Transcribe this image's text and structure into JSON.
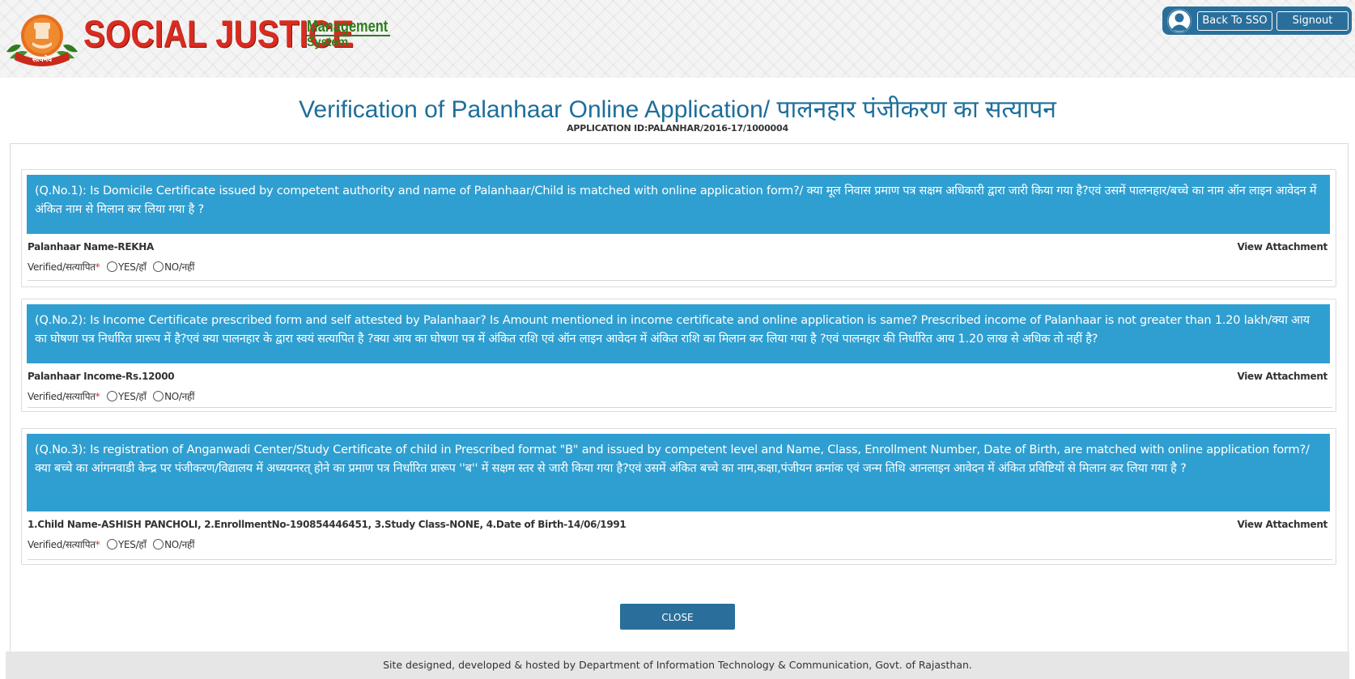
{
  "header": {
    "brand_main": "SOCIAL JUSTICE",
    "brand_sub1": "Management",
    "brand_sub2": "System",
    "back_to_sso": "Back To SSO",
    "signout": "Signout",
    "emblem_text": "सत्यमेव जयते"
  },
  "page": {
    "title": "Verification of Palanhaar Online Application/ पालनहार पंजीकरण का सत्यापन",
    "application_id": "APPLICATION ID:PALANHAR/2016-17/1000004"
  },
  "questions": [
    {
      "question_text": "(Q.No.1): Is Domicile Certificate issued by competent authority and name of Palanhaar/Child is matched with online application form?/ क्या मूल निवास प्रमाण पत्र सक्षम अधिकारी द्वारा जारी किया गया है?एवं उसमें पालनहार/बच्चे का नाम ऑन लाइन आवेदन में अंकित नाम से मिलान कर लिया गया है ?",
      "info": "Palanhaar Name-REKHA",
      "attachment_label": "View Attachment",
      "verified_label": "Verified/सत्यापित",
      "required_mark": "*",
      "yes_label": "YES/हाँ",
      "no_label": "NO/नहीं"
    },
    {
      "question_text": "(Q.No.2): Is Income Certificate prescribed form and self attested by Palanhaar? Is Amount mentioned in income certificate and online application is same? Prescribed income of Palanhaar is not greater than 1.20 lakh/क्या आय का घोषणा पत्र निर्धारित प्रारूप में है?एवं क्या पालनहार के द्वारा स्वयं सत्यापित है ?क्या आय का घोषणा पत्र में अंकित राशि एवं ऑन लाइन आवेदन में अंकित राशि का मिलान कर लिया गया है ?एवं पालनहार की निर्धारित आय 1.20 लाख से अधिक तो नहीं है?",
      "info": "Palanhaar Income-Rs.12000",
      "attachment_label": "View Attachment",
      "verified_label": "Verified/सत्यापित",
      "required_mark": "*",
      "yes_label": "YES/हाँ",
      "no_label": "NO/नहीं"
    },
    {
      "question_text": "(Q.No.3): Is registration of Anganwadi Center/Study Certificate of child in Prescribed format \"B\" and issued by competent level and Name, Class, Enrollment Number, Date of Birth, are matched with online application form?/ क्या बच्चे का आंगनवाडी केन्द्र पर पंजीकरण/विद्यालय में अध्ययनरत् होने का प्रमाण पत्र निर्धारित प्रारूप ''ब'' में सक्षम स्तर से जारी किया गया है?एवं उसमें अंकित बच्चे का नाम,कक्षा,पंजीयन क्रमांक एवं जन्म तिथि आनलाइन आवेदन में अंकित प्रविष्टियों से मिलान कर लिया गया है ?",
      "info": "1.Child Name-ASHISH PANCHOLI, 2.EnrollmentNo-190854446451, 3.Study Class-NONE, 4.Date of Birth-14/06/1991",
      "attachment_label": "View Attachment",
      "verified_label": "Verified/सत्यापित",
      "required_mark": "*",
      "yes_label": "YES/हाँ",
      "no_label": "NO/नहीं"
    }
  ],
  "close_label": "CLOSE",
  "footer": "Site designed, developed & hosted by Department of Information Technology & Communication, Govt. of Rajasthan.",
  "colors": {
    "header_bar": "#2a6f9b",
    "question_header": "#2f9fd1",
    "title": "#1e6e9a",
    "brand_red": "#d92b1f",
    "brand_green": "#2e7d1e"
  }
}
